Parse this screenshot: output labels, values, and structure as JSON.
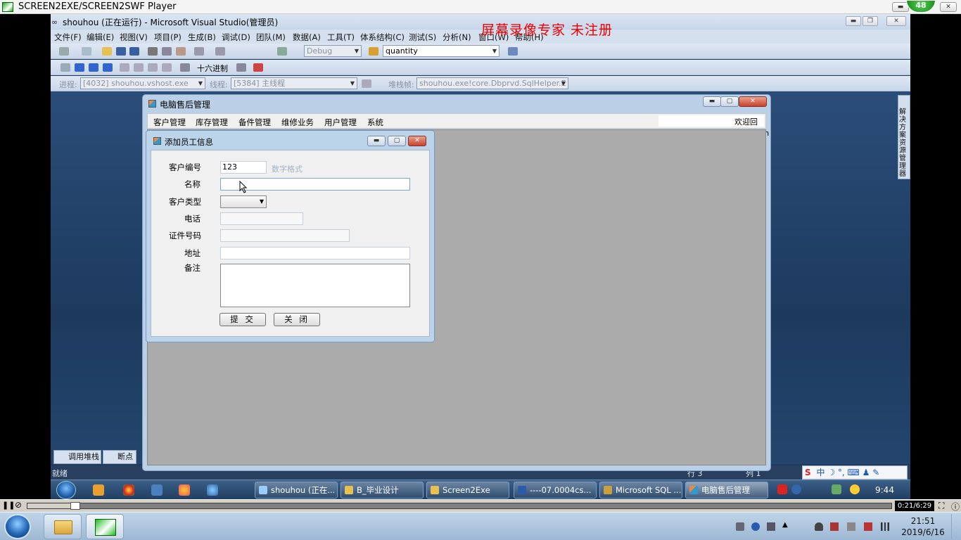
{
  "player": {
    "title": "SCREEN2EXE/SCREEN2SWF Player",
    "badge": "48",
    "time": "0:21/6:29",
    "progress": 0.055
  },
  "vs": {
    "title": "shouhou (正在运行) - Microsoft Visual Studio(管理员)",
    "watermark": "屏幕录像专家  未注册",
    "menu": [
      "文件(F)",
      "编辑(E)",
      "视图(V)",
      "项目(P)",
      "生成(B)",
      "调试(D)",
      "团队(M)",
      "数据(A)",
      "工具(T)",
      "体系结构(C)",
      "测试(S)",
      "分析(N)",
      "窗口(W)",
      "帮助(H)"
    ],
    "config_combo": "Debug",
    "find_combo": "quantity",
    "hex_label": "十六进制",
    "process_label": "进程:",
    "process_value": "[4032] shouhou.vshost.exe",
    "thread_label": "线程:",
    "thread_value": "[5384] 主线程",
    "stack_label": "堆栈帧:",
    "stack_value": "shouhou.exe!core.Dbprvd.SqlHelper.E",
    "status": "就绪",
    "status_line": "行 3",
    "status_col": "列 1",
    "bottom_tabs": [
      "调用堆栈",
      "断点"
    ],
    "side_panel": "解决方案资源管理器"
  },
  "app": {
    "title": "电脑售后管理",
    "menu": [
      "客户管理",
      "库存管理",
      "备件管理",
      "维修业务",
      "用户管理",
      "系统"
    ],
    "welcome": "欢迎回来:admin"
  },
  "dialog": {
    "title": "添加员工信息",
    "fields": {
      "id_label": "客户编号",
      "id_value": "123",
      "id_hint": "数字格式",
      "name_label": "名称",
      "name_value": "",
      "type_label": "客户类型",
      "type_value": "",
      "phone_label": "电话",
      "cert_label": "证件号码",
      "address_label": "地址",
      "note_label": "备注"
    },
    "submit": "提 交",
    "close": "关 闭"
  },
  "inner_taskbar": {
    "tasks": [
      "shouhou (正在...",
      "B_毕业设计",
      "Screen2Exe",
      "----07.0004cs...",
      "Microsoft SQL ...",
      "电脑售后管理"
    ],
    "clock": "9:44"
  },
  "host_taskbar": {
    "time": "21:51",
    "date": "2019/6/16"
  },
  "colors": {
    "watermark": "#ee0000",
    "vs_background": "#1f3a5c",
    "app_frame": "#b9d0e6",
    "mdi_background": "#ababab"
  }
}
